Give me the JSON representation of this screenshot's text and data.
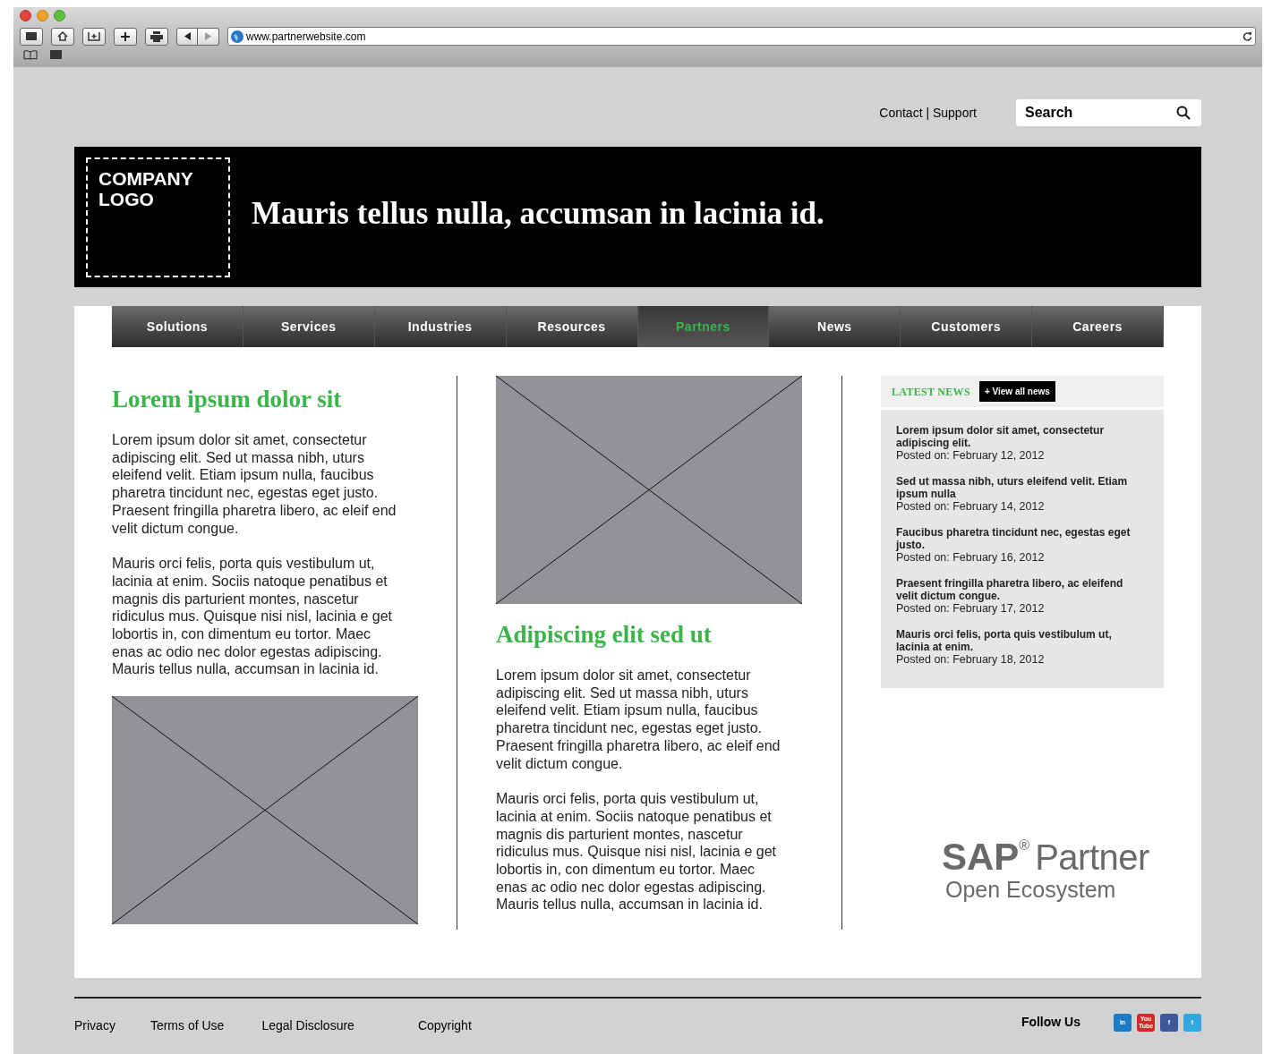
{
  "browser": {
    "url": "www.partnerwebsite.com"
  },
  "top_links": {
    "contact": "Contact | Support",
    "search": {
      "placeholder": "Search"
    }
  },
  "header": {
    "logo_lines": [
      "COMPANY",
      "LOGO"
    ],
    "headline": "Mauris tellus nulla, accumsan in lacinia id."
  },
  "nav": [
    {
      "label": "Solutions",
      "selected": false
    },
    {
      "label": "Services",
      "selected": false
    },
    {
      "label": "Industries",
      "selected": false
    },
    {
      "label": "Resources",
      "selected": false
    },
    {
      "label": "Partners",
      "selected": true
    },
    {
      "label": "News",
      "selected": false
    },
    {
      "label": "Customers",
      "selected": false
    },
    {
      "label": "Careers",
      "selected": false
    }
  ],
  "left_column": {
    "heading": "Lorem ipsum dolor sit",
    "paragraphs": [
      "Lorem ipsum dolor sit amet, consectetur adipiscing elit. Sed ut massa nibh, uturs eleifend velit. Etiam ipsum nulla, faucibus pharetra tincidunt nec, egestas eget justo. Praesent fringilla pharetra libero, ac eleif end velit dictum congue.",
      "Mauris orci felis, porta quis vestibulum ut, lacinia at enim. Sociis natoque penatibus et magnis dis parturient montes, nascetur ridiculus mus. Quisque nisi nisl, lacinia e get lobortis in, con dimentum eu tortor. Maec enas ac odio nec dolor egestas adipiscing. Mauris tellus nulla, accumsan in lacinia id."
    ]
  },
  "middle_column": {
    "heading": "Adipiscing elit sed ut",
    "paragraphs": [
      "Lorem ipsum dolor sit amet, consectetur adipiscing elit. Sed ut massa nibh, uturs eleifend velit. Etiam ipsum nulla, faucibus pharetra tincidunt nec, egestas eget justo. Praesent fringilla pharetra libero, ac eleif end velit dictum congue.",
      "Mauris orci felis, porta quis vestibulum ut, lacinia at enim. Sociis natoque penatibus et magnis dis parturient montes, nascetur ridiculus mus. Quisque nisi nisl, lacinia e get lobortis in, con dimentum eu tortor. Maec enas ac odio nec dolor egestas adipiscing. Mauris tellus nulla, accumsan in lacinia id."
    ]
  },
  "latest_news": {
    "title": "LATEST NEWS",
    "view_all": "+ View all news",
    "items": [
      {
        "title": "Lorem ipsum dolor sit amet, consectetur adipiscing elit.",
        "date": "Posted on: February 12, 2012"
      },
      {
        "title": "Sed ut massa nibh, uturs eleifend velit. Etiam ipsum nulla",
        "date": "Posted on: February 14, 2012"
      },
      {
        "title": "Faucibus pharetra tincidunt nec, egestas eget justo.",
        "date": "Posted on: February 16, 2012"
      },
      {
        "title": "Praesent fringilla pharetra libero, ac eleifend velit dictum congue.",
        "date": "Posted on: February 17, 2012"
      },
      {
        "title": "Mauris orci felis, porta quis vestibulum ut, lacinia at enim.",
        "date": "Posted on: February 18, 2012"
      }
    ]
  },
  "partner_logo": {
    "brand": "SAP",
    "mark": "®",
    "word": "Partner",
    "tagline": "Open Ecosystem"
  },
  "footer": {
    "links": [
      "Privacy",
      "Terms of Use",
      "Legal Disclosure",
      "Copyright"
    ],
    "follow": "Follow Us",
    "social": [
      {
        "label": "in",
        "color": "#1a7bc4"
      },
      {
        "label": "You Tube",
        "color": "#d42a26"
      },
      {
        "label": "f",
        "color": "#3b5998"
      },
      {
        "label": "t",
        "color": "#33a8e0"
      }
    ]
  }
}
